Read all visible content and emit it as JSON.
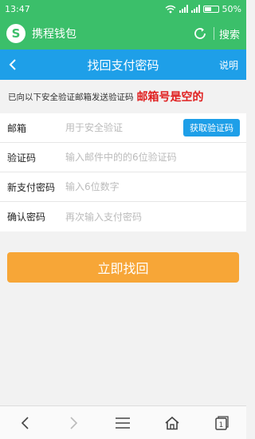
{
  "status_bar": {
    "time": "13:47",
    "battery": "50%"
  },
  "app_bar": {
    "name": "携程钱包",
    "logo": "S",
    "search_label": "搜索"
  },
  "title_bar": {
    "back": "‹",
    "title": "找回支付密码",
    "help_label": "说明"
  },
  "hint": {
    "message": "已向以下安全验证邮箱发送验证码",
    "annotation": "邮箱号是空的"
  },
  "form": {
    "email": {
      "label": "邮箱",
      "placeholder": "用于安全验证",
      "value": ""
    },
    "get_code_label": "获取验证码",
    "code": {
      "label": "验证码",
      "placeholder": "输入邮件中的的6位验证码"
    },
    "new_password": {
      "label": "新支付密码",
      "placeholder": "输入6位数字"
    },
    "confirm_password": {
      "label": "确认密码",
      "placeholder": "再次输入支付密码"
    }
  },
  "submit_label": "立即找回",
  "nav_bar": {
    "tab_count": "1"
  },
  "colors": {
    "app_green": "#3bbf6a",
    "title_blue": "#1e9fe8",
    "submit_orange": "#f7a637",
    "annotation_red": "#e02020"
  }
}
